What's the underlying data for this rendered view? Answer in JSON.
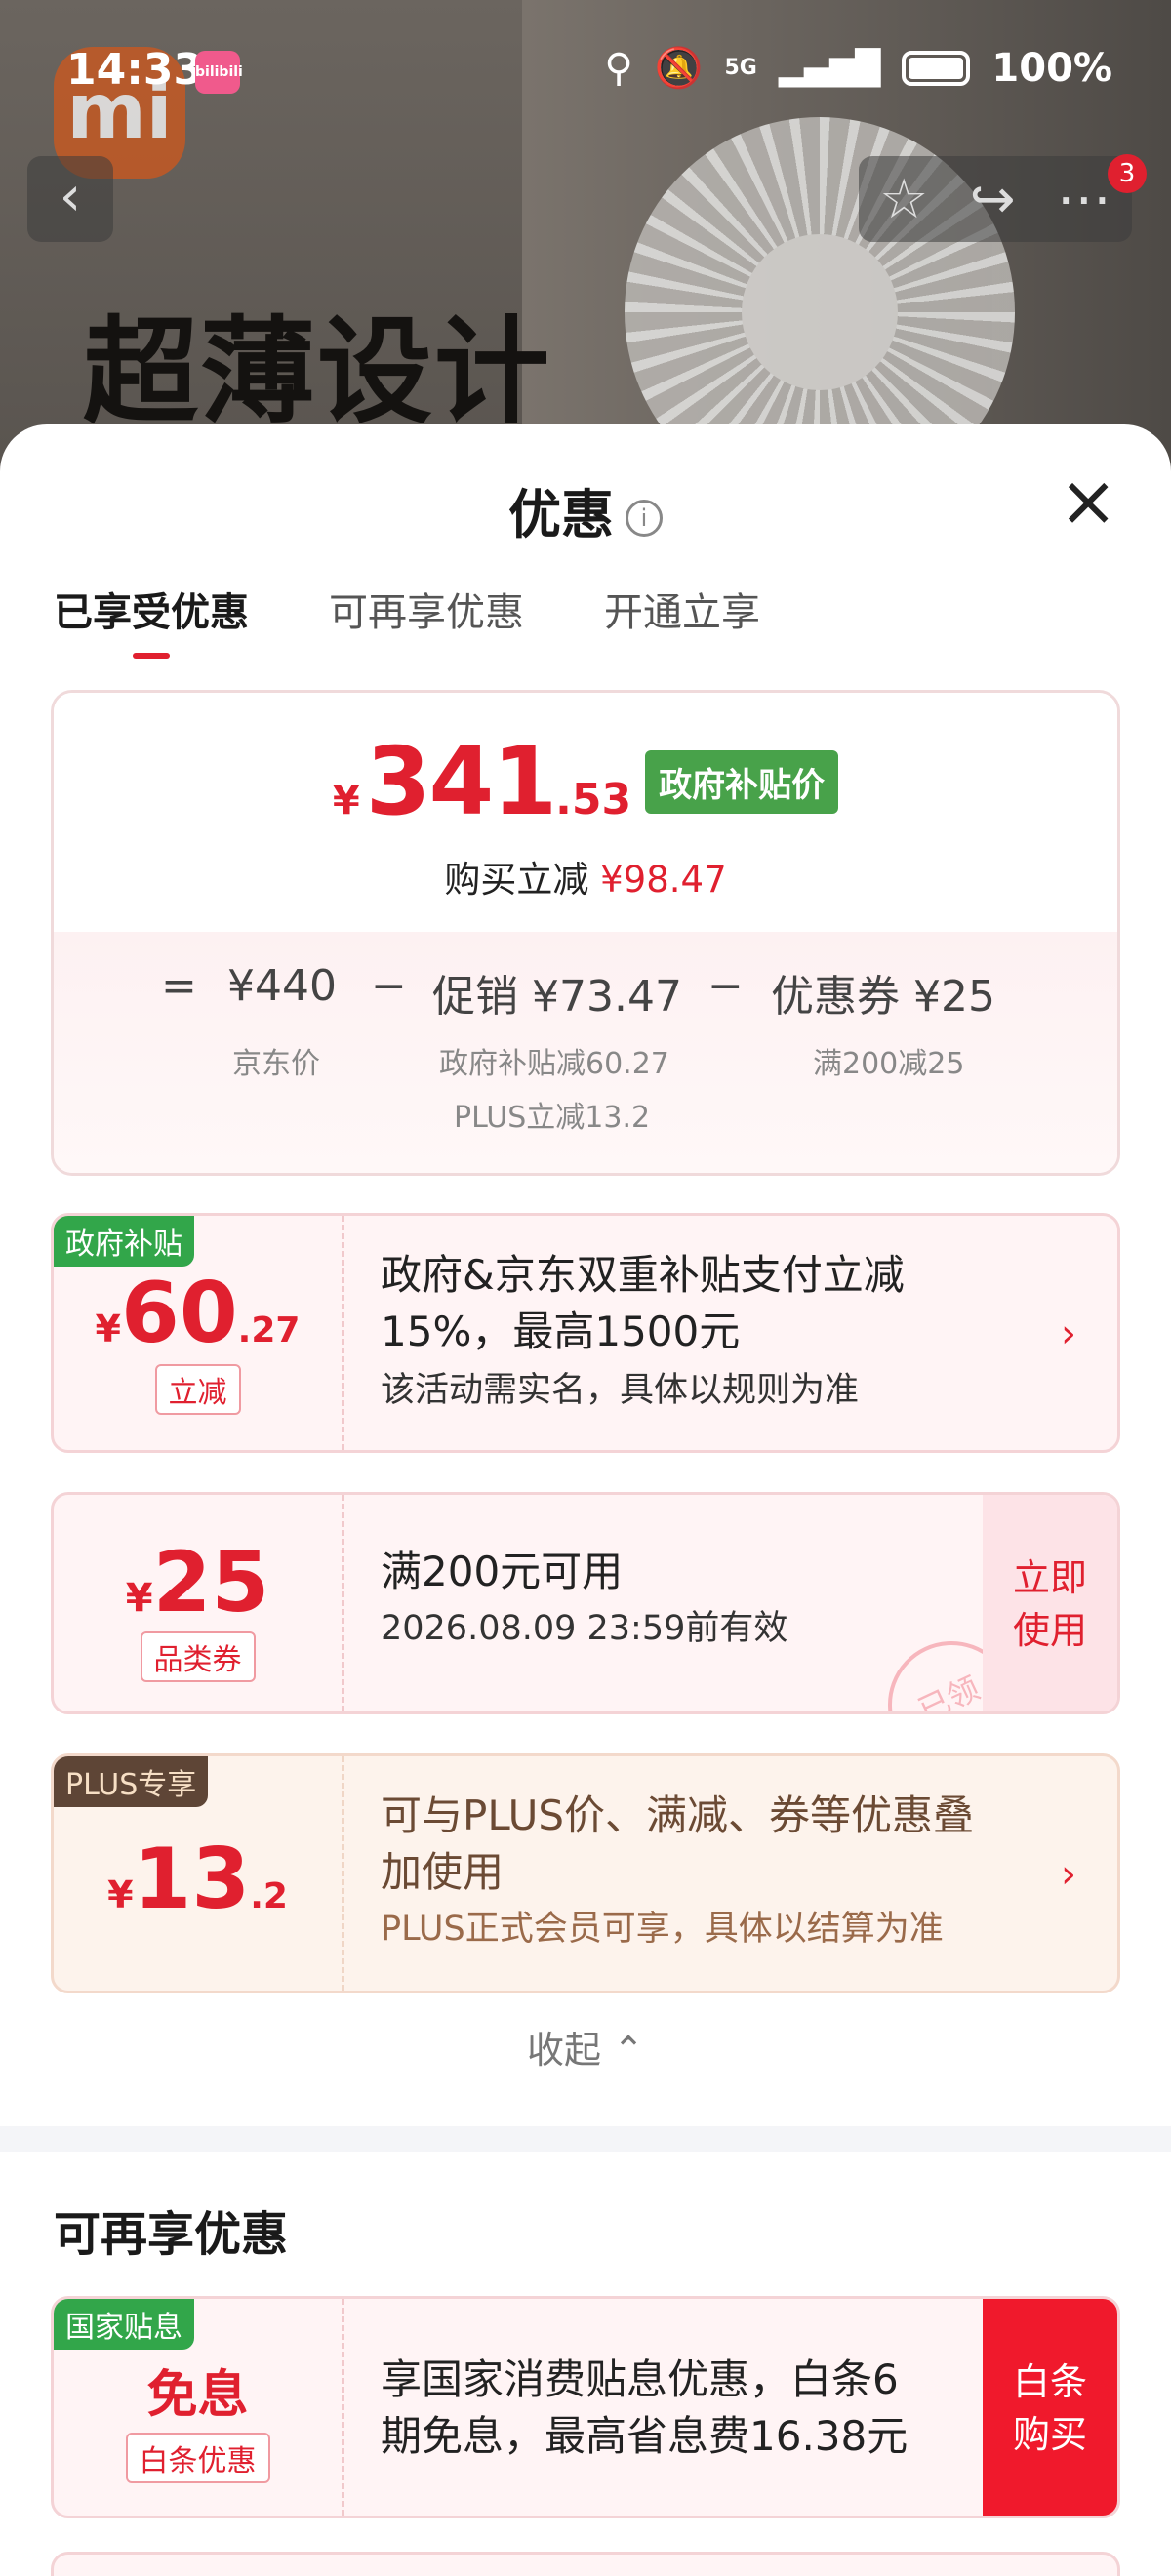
{
  "status_bar": {
    "time": "14:33",
    "app_badge": "bilibili",
    "network": "5G",
    "battery": "100%"
  },
  "hero": {
    "brand_logo": "mi",
    "headline_line1": "超薄设计",
    "headline_line2": ""
  },
  "nav": {
    "notification_count": "3"
  },
  "sheet": {
    "title": "优惠",
    "tabs": [
      "已享受优惠",
      "可再享优惠",
      "开通立享"
    ],
    "active_tab": 0
  },
  "summary": {
    "price_currency": "¥",
    "price_int": "341",
    "price_dec": ".53",
    "price_tag": "政府补贴价",
    "instant_label": "购买立减",
    "instant_amount": "¥98.47",
    "equals": "=",
    "jd_price": "¥440",
    "jd_price_label": "京东价",
    "minus1": "−",
    "promo": "促销 ¥73.47",
    "promo_detail1": "政府补贴减60.27",
    "promo_detail2": "PLUS立减13.2",
    "minus2": "−",
    "coupon": "优惠券 ¥25",
    "coupon_detail": "满200减25"
  },
  "coupons": [
    {
      "tag": "政府补贴",
      "currency": "¥",
      "amount_int": "60",
      "amount_dec": ".27",
      "type": "立减",
      "line1": "政府&京东双重补贴支付立减",
      "line2": "15%，最高1500元",
      "note": "该活动需实名，具体以规则为准"
    },
    {
      "currency": "¥",
      "amount_int": "25",
      "type": "品类券",
      "line1": "满200元可用",
      "note": "2026.08.09 23:59前有效",
      "action_line1": "立即",
      "action_line2": "使用",
      "stamp": "已领"
    },
    {
      "tag": "PLUS专享",
      "currency": "¥",
      "amount_int": "13",
      "amount_dec": ".2",
      "line1": "可与PLUS价、满减、券等优惠叠",
      "line2": "加使用",
      "note": "PLUS正式会员可享，具体以结算为准"
    }
  ],
  "collapse_label": "收起",
  "more_section": {
    "title": "可再享优惠",
    "items": [
      {
        "tag": "国家贴息",
        "headline": "免息",
        "type": "白条优惠",
        "line1": "享国家消费贴息优惠，白条6",
        "line2": "期免息，最高省息费16.38元",
        "action_line1": "白条",
        "action_line2": "购买"
      }
    ]
  },
  "colors": {
    "accent_red": "#e0202f",
    "gov_green": "#48a24a",
    "plus_brown": "#5e4536"
  }
}
